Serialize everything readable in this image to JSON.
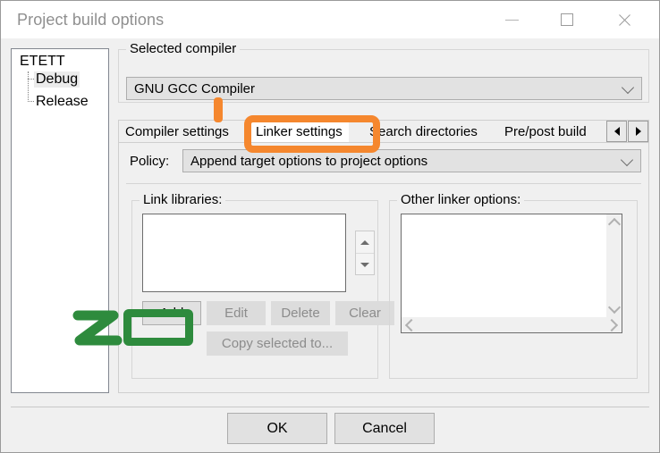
{
  "window": {
    "title": "Project build options",
    "controls": {
      "minimize": "minimize-icon",
      "maximize": "maximize-icon",
      "close": "close-icon"
    }
  },
  "tree": {
    "root": "ETETT",
    "children": [
      {
        "label": "Debug",
        "selected": true
      },
      {
        "label": "Release",
        "selected": false
      }
    ]
  },
  "compiler_group": {
    "label": "Selected compiler",
    "selected": "GNU GCC Compiler"
  },
  "tabs": {
    "items": [
      {
        "label": "Compiler settings",
        "active": false
      },
      {
        "label": "Linker settings",
        "active": true
      },
      {
        "label": "Search directories",
        "active": false
      },
      {
        "label": "Pre/post build",
        "active": false
      }
    ],
    "scroll_left": "◄",
    "scroll_right": "►"
  },
  "linker_page": {
    "policy_label": "Policy:",
    "policy_value": "Append target options to project options",
    "link_libraries": {
      "label": "Link libraries:",
      "items": [],
      "buttons": [
        {
          "label": "Add",
          "enabled": true
        },
        {
          "label": "Edit",
          "enabled": false
        },
        {
          "label": "Delete",
          "enabled": false
        },
        {
          "label": "Clear",
          "enabled": false
        }
      ],
      "copy_button": {
        "label": "Copy selected to...",
        "enabled": false
      }
    },
    "other_linker_options": {
      "label": "Other linker options:",
      "value": ""
    }
  },
  "footer": {
    "ok": "OK",
    "cancel": "Cancel"
  },
  "annotations": {
    "orange_color": "#f5872e",
    "green_color": "#2e8b3d",
    "orange_highlight_target": "Linker settings",
    "green_highlight_target": "Add"
  }
}
